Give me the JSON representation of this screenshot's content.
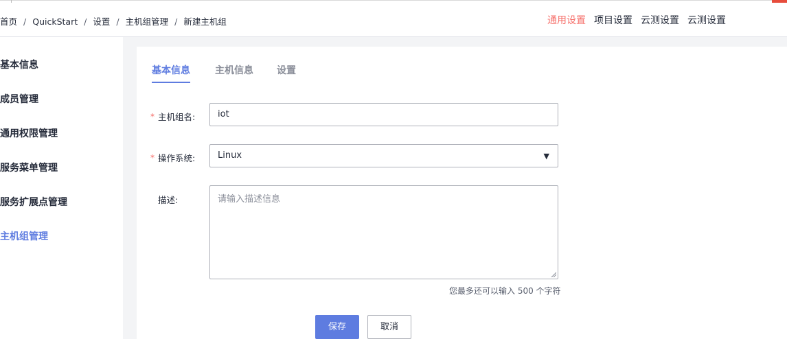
{
  "breadcrumb": [
    "首页",
    "QuickStart",
    "设置",
    "主机组管理",
    "新建主机组"
  ],
  "breadcrumb_separator": "/",
  "top_nav": [
    {
      "label": "通用设置",
      "active": true
    },
    {
      "label": "项目设置",
      "active": false
    },
    {
      "label": "云测设置",
      "active": false
    },
    {
      "label": "云测设置",
      "active": false
    }
  ],
  "sidebar": {
    "items": [
      {
        "label": "基本信息"
      },
      {
        "label": "成员管理"
      },
      {
        "label": "通用权限管理"
      },
      {
        "label": "服务菜单管理"
      },
      {
        "label": "服务扩展点管理"
      },
      {
        "label": "主机组管理",
        "active": true
      }
    ]
  },
  "tabs": [
    {
      "label": "基本信息",
      "active": true
    },
    {
      "label": "主机信息"
    },
    {
      "label": "设置"
    }
  ],
  "form": {
    "required_mark": "*",
    "host_group_name": {
      "label": "主机组名:",
      "value": "iot"
    },
    "os": {
      "label": "操作系统:",
      "value": "Linux"
    },
    "description": {
      "label": "描述:",
      "placeholder": "请输入描述信息",
      "hint": "您最多还可以输入 500 个字符"
    }
  },
  "buttons": {
    "save": "保存",
    "cancel": "取消"
  },
  "colors": {
    "accent": "#5e7ce0",
    "active_nav": "#f66f6a",
    "required": "#f66f6a"
  },
  "icons": {
    "select_caret": "▼"
  }
}
